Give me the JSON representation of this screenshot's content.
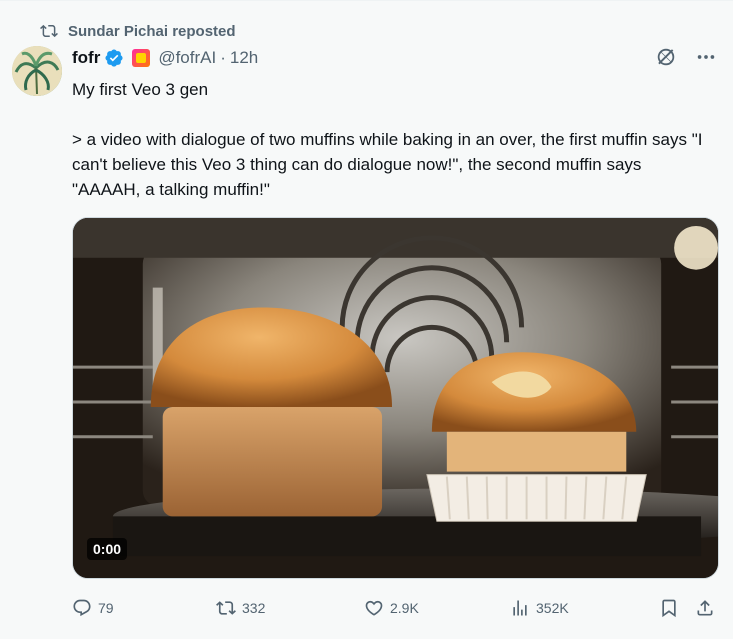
{
  "repost": {
    "label": "Sundar Pichai reposted"
  },
  "author": {
    "name": "fofr",
    "handle": "@fofrAI",
    "separator": "·",
    "time": "12h"
  },
  "tweet": {
    "text": "My first Veo 3 gen\n\n> a video with dialogue of two muffins while baking in an over, the first muffin says \"I can't believe this Veo 3 thing can do dialogue now!\", the second muffin says \"AAAAH, a talking muffin!\""
  },
  "media": {
    "duration": "0:00"
  },
  "metrics": {
    "replies": "79",
    "reposts": "332",
    "likes": "2.9K",
    "views": "352K"
  },
  "icons": {
    "repost": "repost-icon",
    "verified": "verified-badge-icon",
    "grok": "grok-icon",
    "more": "more-icon",
    "reply": "reply-icon",
    "like": "like-icon",
    "views": "views-icon",
    "bookmark": "bookmark-icon",
    "share": "share-icon"
  },
  "colors": {
    "text": "#0f1419",
    "muted": "#536471",
    "verified": "#1d9bf0"
  }
}
